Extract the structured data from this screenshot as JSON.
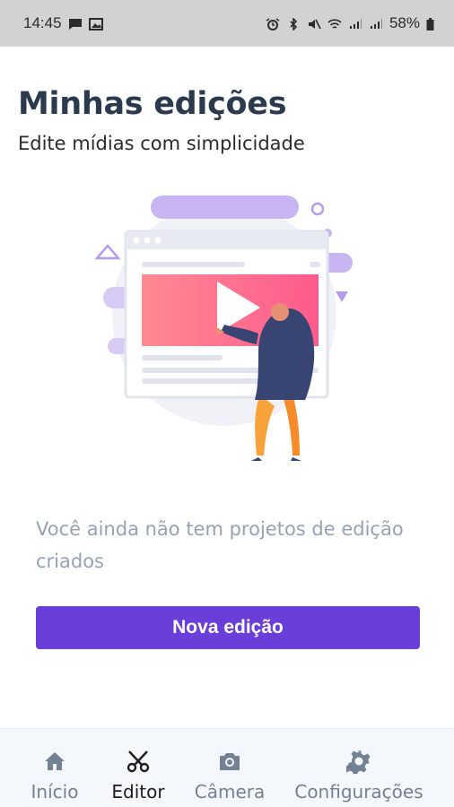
{
  "status_bar": {
    "time": "14:45",
    "battery": "58%",
    "left_icons": [
      "chat-icon",
      "image-icon"
    ],
    "right_icons": [
      "alarm-icon",
      "bluetooth-icon",
      "mute-icon",
      "wifi-icon",
      "signal-icon",
      "signal-icon",
      "battery-icon"
    ]
  },
  "header": {
    "title": "Minhas edições",
    "subtitle": "Edite mídias com simplicidade"
  },
  "empty_state": {
    "message": "Você ainda não tem projetos de edição criados",
    "illustration_icon": "video-editing-illustration"
  },
  "actions": {
    "new_edit_label": "Nova edição",
    "button_color": "#6a3ed8"
  },
  "bottom_nav": {
    "items": [
      {
        "label": "Início",
        "icon": "home-icon",
        "active": false
      },
      {
        "label": "Editor",
        "icon": "scissors-icon",
        "active": true
      },
      {
        "label": "Câmera",
        "icon": "camera-icon",
        "active": false
      },
      {
        "label": "Configurações",
        "icon": "gear-icon",
        "active": false
      }
    ]
  }
}
